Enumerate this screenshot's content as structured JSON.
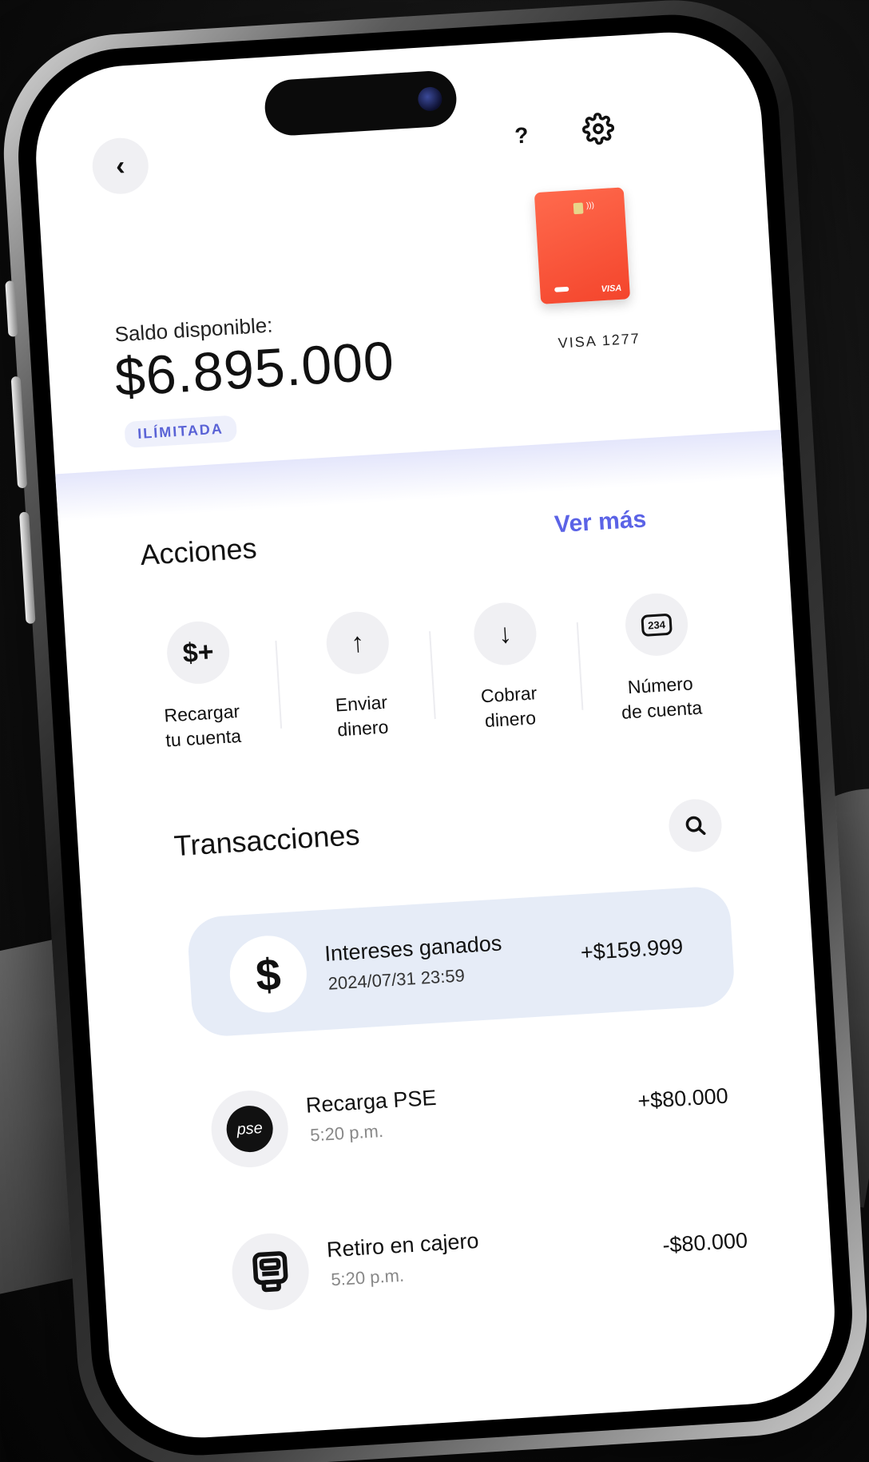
{
  "header": {
    "back_icon": "chevron-left-icon",
    "help_label": "?",
    "settings_icon": "gear-icon"
  },
  "card": {
    "brand": "VISA",
    "caption": "VISA 1277",
    "color": "#f4452c"
  },
  "balance": {
    "label": "Saldo disponible:",
    "value": "$6.895.000",
    "badge": "ILÍMITADA"
  },
  "actions": {
    "title": "Acciones",
    "see_more": "Ver más",
    "items": [
      {
        "icon": "$+",
        "line1": "Recargar",
        "line2": "tu cuenta"
      },
      {
        "icon": "↑",
        "line1": "Enviar",
        "line2": "dinero"
      },
      {
        "icon": "↓",
        "line1": "Cobrar",
        "line2": "dinero"
      },
      {
        "icon": "234",
        "line1": "Número",
        "line2": "de cuenta"
      }
    ]
  },
  "transactions": {
    "title": "Transacciones",
    "search_icon": "search-icon",
    "items": [
      {
        "icon": "$",
        "title": "Intereses ganados",
        "subtitle": "2024/07/31 23:59",
        "amount": "+$159.999"
      },
      {
        "icon": "pse",
        "title": "Recarga PSE",
        "subtitle": "5:20 p.m.",
        "amount": "+$80.000"
      },
      {
        "icon": "atm-icon",
        "title": "Retiro en cajero",
        "subtitle": "5:20 p.m.",
        "amount": "-$80.000"
      }
    ]
  },
  "colors": {
    "accent": "#5b63e6",
    "highlight_bg": "#e6ecf7",
    "card": "#f4452c"
  }
}
